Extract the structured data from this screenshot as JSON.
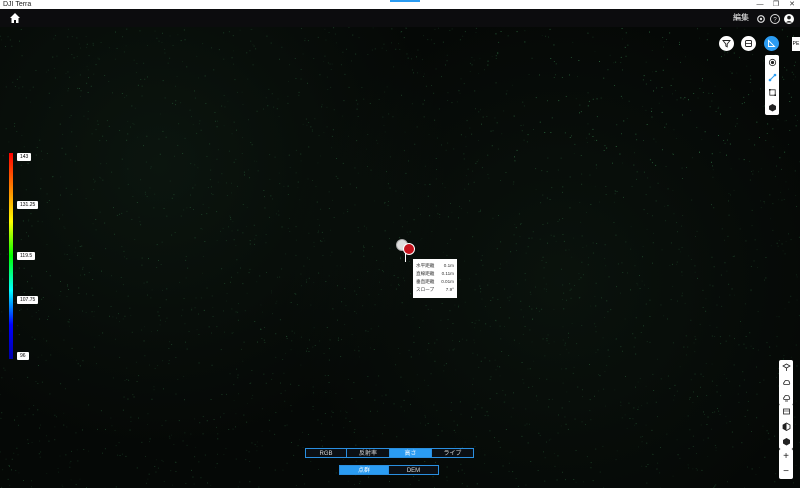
{
  "window": {
    "title": "DJI Terra",
    "accent_color": "#2b9cf2",
    "controls": [
      "—",
      "❐",
      "✕"
    ]
  },
  "topbar": {
    "home_icon": "home-icon",
    "edit_label": "編集",
    "icons": [
      "gear-icon",
      "help-icon",
      "user-icon"
    ]
  },
  "viewport": {
    "top_tools": [
      "filter-icon",
      "layers-icon",
      "measure-icon"
    ],
    "side_tab": "PE",
    "right_panel_top": [
      "point-icon",
      "distance-icon",
      "area-icon",
      "volume-icon"
    ],
    "right_panel_bottom": [
      "pointcloud-view-icon",
      "cloud-icon-1",
      "cloud-icon-2"
    ],
    "right_panel_view": [
      "frame-icon",
      "shade-icon-1",
      "shade-icon-2"
    ],
    "zoom": [
      "+",
      "−"
    ]
  },
  "legend": {
    "colors": [
      "#ff0000",
      "#ff7f00",
      "#ffff00",
      "#00ff00",
      "#00ffff",
      "#0000ff",
      "#0000aa"
    ],
    "ticks": [
      "143",
      "131.25",
      "119.5",
      "107.75",
      "96"
    ]
  },
  "measurement": {
    "rows": [
      {
        "label": "水平距離",
        "value": "0.1m"
      },
      {
        "label": "直線距離",
        "value": "0.11m"
      },
      {
        "label": "垂直距離",
        "value": "0.01m"
      },
      {
        "label": "スロープ",
        "value": "7.9°"
      }
    ]
  },
  "render_modes": {
    "row1": [
      "RGB",
      "反射率",
      "高さ",
      "ライブ"
    ],
    "row1_active": "高さ",
    "row2": [
      "点群",
      "DEM"
    ],
    "row2_active": "点群"
  }
}
